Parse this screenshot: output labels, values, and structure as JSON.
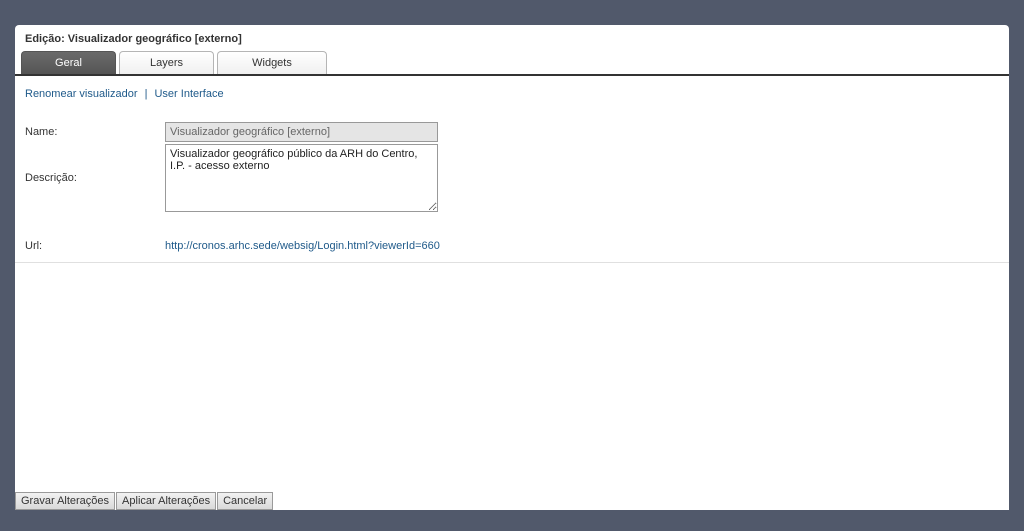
{
  "panel": {
    "title": "Edição: Visualizador geográfico [externo]"
  },
  "tabs": {
    "geral": "Geral",
    "layers": "Layers",
    "widgets": "Widgets"
  },
  "toolbar": {
    "renomear": "Renomear visualizador",
    "sep": "|",
    "ui": "User Interface"
  },
  "form": {
    "name_label": "Name:",
    "name_value": "Visualizador geográfico [externo]",
    "desc_label": "Descrição:",
    "desc_value": "Visualizador geográfico público da ARH do Centro, I.P. - acesso externo",
    "url_label": "Url:",
    "url_value": "http://cronos.arhc.sede/websig/Login.html?viewerId=660"
  },
  "buttons": {
    "gravar": "Gravar Alterações",
    "aplicar": "Aplicar Alterações",
    "cancelar": "Cancelar"
  }
}
